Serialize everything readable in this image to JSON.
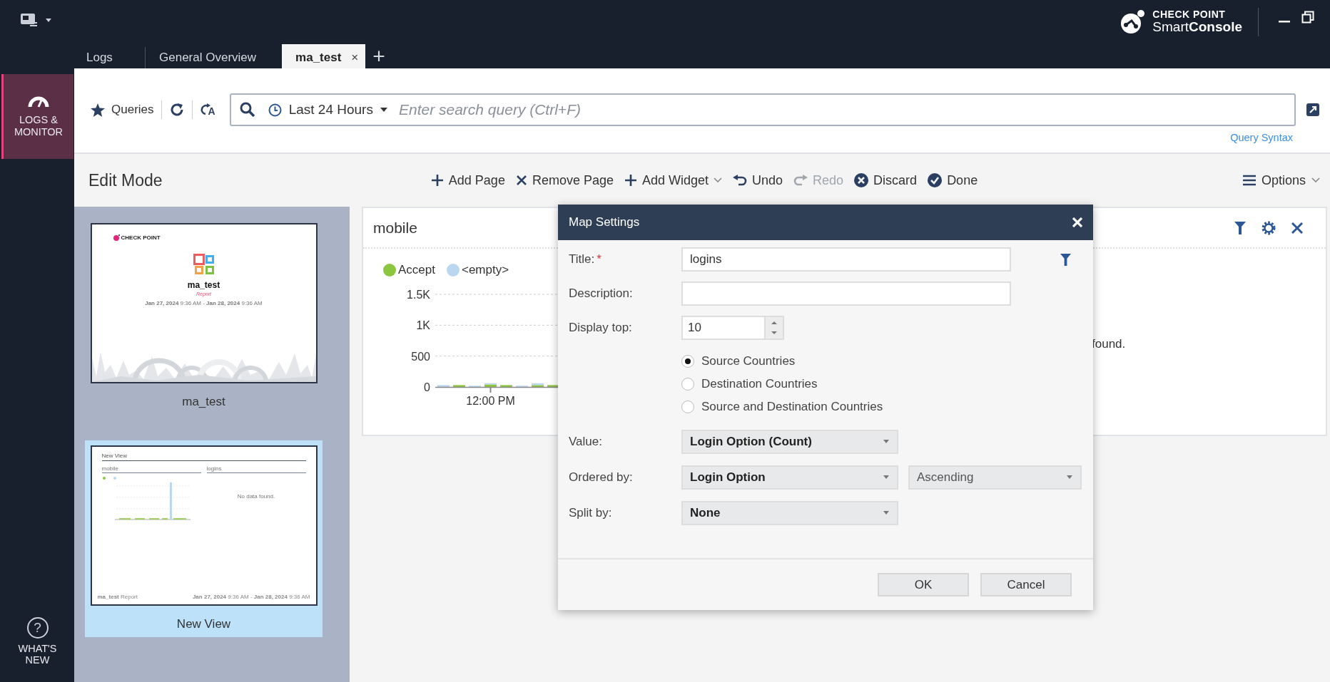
{
  "app_bar": {
    "brand_top": "CHECK POINT",
    "brand_bottom": "Smart**Console**"
  },
  "tabs": [
    {
      "label": "Logs",
      "selected": false
    },
    {
      "label": "General Overview",
      "selected": false
    },
    {
      "label": "ma_test",
      "selected": true,
      "close": "×"
    }
  ],
  "new_tab": "+",
  "rail": {
    "items": [
      {
        "label": "LOGS & MONITOR",
        "selected": true
      }
    ],
    "help": {
      "glyph": "?",
      "label": "WHAT'S NEW"
    }
  },
  "query_bar": {
    "queries": "Queries",
    "reset_badge": "A",
    "time_range": "Last 24 Hours",
    "search": {
      "placeholder": "Enter search query (Ctrl+F)"
    },
    "syntax_link": "Query Syntax"
  },
  "edit_bar": {
    "title": "Edit Mode",
    "actions": [
      {
        "kind": "add",
        "label": "Add Page",
        "disabled": false,
        "menu": false
      },
      {
        "kind": "remove",
        "label": "Remove Page",
        "disabled": false,
        "menu": false
      },
      {
        "kind": "add",
        "label": "Add Widget",
        "disabled": false,
        "menu": true
      },
      {
        "kind": "undo",
        "label": "Undo",
        "disabled": false,
        "menu": false
      },
      {
        "kind": "redo",
        "label": "Redo",
        "disabled": true,
        "menu": false
      },
      {
        "kind": "discard",
        "label": "Discard",
        "disabled": false,
        "menu": false
      },
      {
        "kind": "done",
        "label": "Done",
        "disabled": false,
        "menu": false
      }
    ],
    "options": "Options"
  },
  "pages": [
    {
      "kind": "cover",
      "name": "ma_test",
      "selected": false,
      "logo": "CHECK POINT",
      "title": "ma_test",
      "subtitle": "Report",
      "date_range": "**Jan 27, 2024** 9:36 AM - **Jan 28, 2024** 9:36 AM"
    },
    {
      "kind": "view",
      "name": "New View",
      "selected": true,
      "heading": "New View",
      "widgets": [
        "mobile",
        "logins"
      ],
      "message": "No data found.",
      "footer_left": "**ma_test** Report",
      "footer_right": "**Jan 27, 2024** 9:36 AM - **Jan 28, 2024** 9:36 AM"
    }
  ],
  "widget": {
    "title": "mobile",
    "message": "found.",
    "time_label": "12:00 PM",
    "chart_data": {
      "type": "bar",
      "stacked": true,
      "legend": "top",
      "series": [
        {
          "name": "Accept",
          "color": "#8cc63f",
          "values": [
            null,
            30,
            null,
            40,
            30,
            null,
            30,
            30
          ]
        },
        {
          "name": "<empty>",
          "color": "#b9d8f0",
          "values": [
            30,
            null,
            20,
            20,
            null,
            20,
            30,
            null
          ]
        }
      ],
      "ylim": [
        0,
        1500
      ],
      "yticks": [
        {
          "value": 0,
          "label": "0"
        },
        {
          "value": 500,
          "label": "500"
        },
        {
          "value": 1000,
          "label": "1K"
        },
        {
          "value": 1500,
          "label": "1.5K"
        }
      ]
    }
  },
  "dialog": {
    "title": "Map Settings",
    "fields": [
      {
        "kind": "text",
        "label": "Title:",
        "required_mark": "*",
        "value": "logins",
        "filter": true
      },
      {
        "kind": "text",
        "label": "Description:"
      },
      {
        "kind": "spin",
        "label": "Display top:",
        "value": "10"
      },
      {
        "kind": "radio",
        "options": [
          {
            "label": "Source Countries",
            "selected": true
          },
          {
            "label": "Destination Countries",
            "selected": false
          },
          {
            "label": "Source and Destination Countries",
            "selected": false
          }
        ]
      },
      {
        "kind": "select",
        "label": "Value:",
        "selects": [
          "Login Option (Count)"
        ]
      },
      {
        "kind": "select",
        "label": "Ordered by:",
        "selects": [
          "Login Option",
          "Ascending"
        ]
      },
      {
        "kind": "select",
        "label": "Split by:",
        "selects": [
          "None"
        ]
      }
    ],
    "buttons": [
      "OK",
      "Cancel"
    ]
  }
}
